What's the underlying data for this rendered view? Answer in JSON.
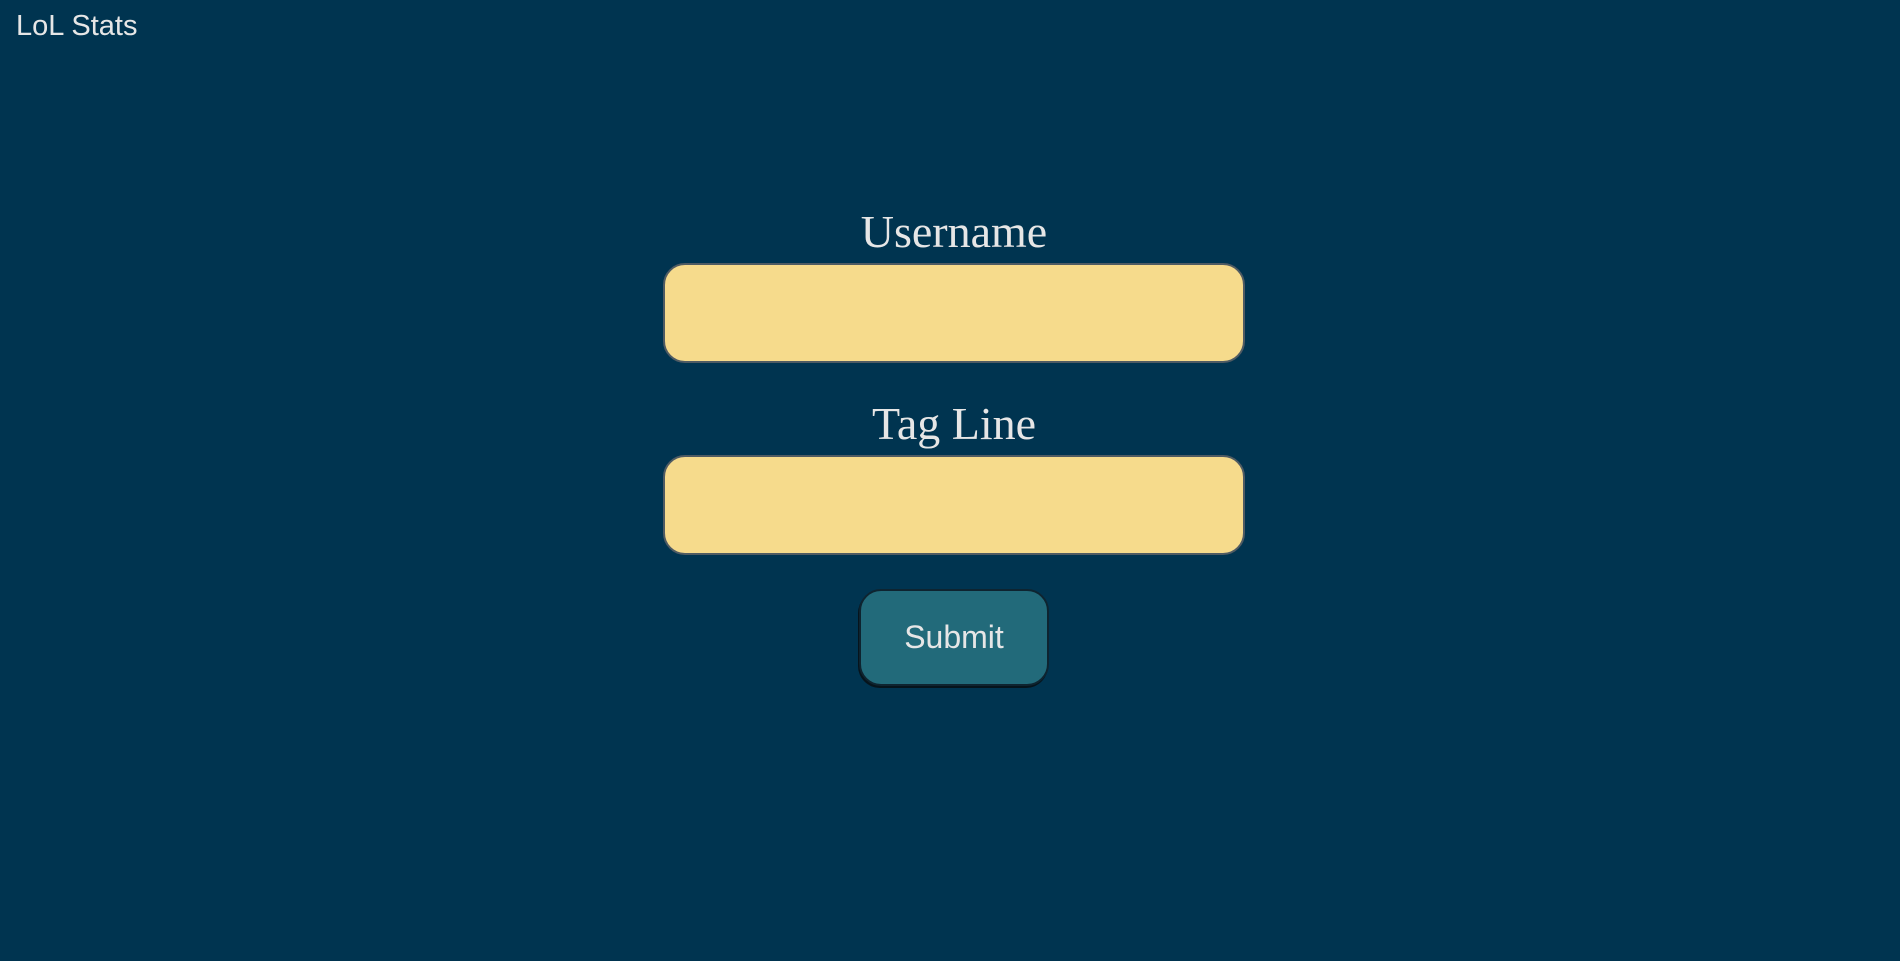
{
  "app": {
    "title": "LoL Stats"
  },
  "form": {
    "username_label": "Username",
    "username_value": "",
    "tagline_label": "Tag Line",
    "tagline_value": "",
    "submit_label": "Submit"
  },
  "colors": {
    "background": "#003450",
    "input_fill": "#f6db8c",
    "button_fill": "#226a7a",
    "text": "#e6e6e6"
  }
}
